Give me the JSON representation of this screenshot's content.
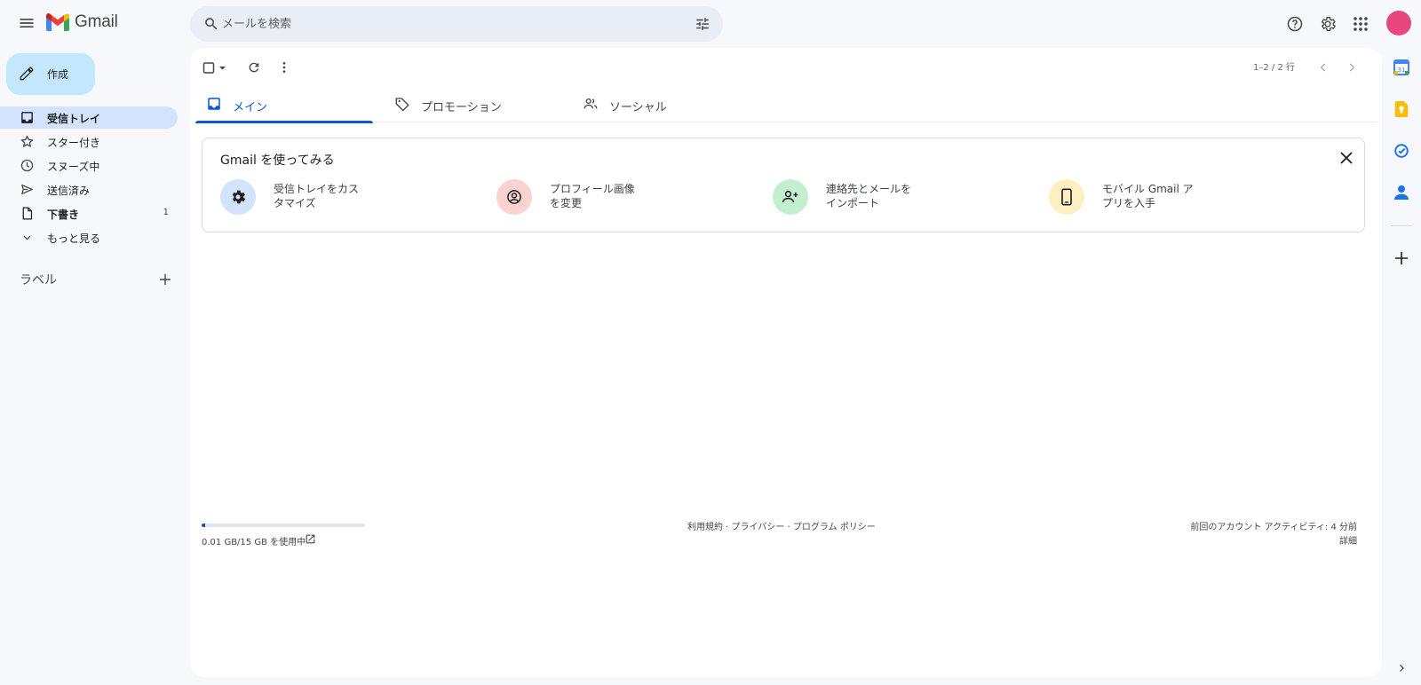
{
  "header": {
    "app_name": "Gmail",
    "search_placeholder": "メールを検索",
    "menu_icon": "hamburger-menu-icon",
    "icons": [
      "help-icon",
      "settings-gear-icon",
      "apps-grid-icon"
    ],
    "avatar_color": "#e8467c"
  },
  "sidebar": {
    "compose_label": "作成",
    "items": [
      {
        "label": "受信トレイ",
        "icon": "inbox-icon",
        "active": true,
        "count": ""
      },
      {
        "label": "スター付き",
        "icon": "star-icon",
        "active": false,
        "count": ""
      },
      {
        "label": "スヌーズ中",
        "icon": "clock-icon",
        "active": false,
        "count": ""
      },
      {
        "label": "送信済み",
        "icon": "send-icon",
        "active": false,
        "count": ""
      },
      {
        "label": "下書き",
        "icon": "draft-icon",
        "active": false,
        "count": "1"
      },
      {
        "label": "もっと見る",
        "icon": "chevron-down-icon",
        "active": false,
        "count": ""
      }
    ],
    "labels_title": "ラベル"
  },
  "toolbar": {
    "pager_text": "1–2 / 2 行"
  },
  "tabs": [
    {
      "label": "メイン",
      "icon": "inbox-icon",
      "active": true
    },
    {
      "label": "プロモーション",
      "icon": "tag-icon",
      "active": false
    },
    {
      "label": "ソーシャル",
      "icon": "people-icon",
      "active": false
    }
  ],
  "getting_started": {
    "title": "Gmail を使ってみる",
    "items": [
      {
        "line1": "受信トレイをカス",
        "line2": "タマイズ",
        "icon": "settings-gear-icon",
        "bg": "#d3e3fd"
      },
      {
        "line1": "プロフィール画像",
        "line2": "を変更",
        "icon": "account-circle-icon",
        "bg": "#fad2cf"
      },
      {
        "line1": "連絡先とメールを",
        "line2": "インポート",
        "icon": "person-add-icon",
        "bg": "#c4eed0"
      },
      {
        "line1": "モバイル Gmail ア",
        "line2": "プリを入手",
        "icon": "smartphone-icon",
        "bg": "#feefc3"
      }
    ]
  },
  "footer": {
    "storage_text": "0.01 GB/15 GB を使用中",
    "storage_used_fraction": 0.001,
    "links_text": "利用規約 · プライバシー · プログラム ポリシー",
    "activity_text": "前回のアカウント アクティビティ: 4 分前",
    "activity_detail": "詳細"
  },
  "right_rail": {
    "icons": [
      "calendar-icon",
      "keep-icon",
      "tasks-icon",
      "contacts-icon",
      "add-icon",
      "expand-chevron-icon"
    ]
  }
}
